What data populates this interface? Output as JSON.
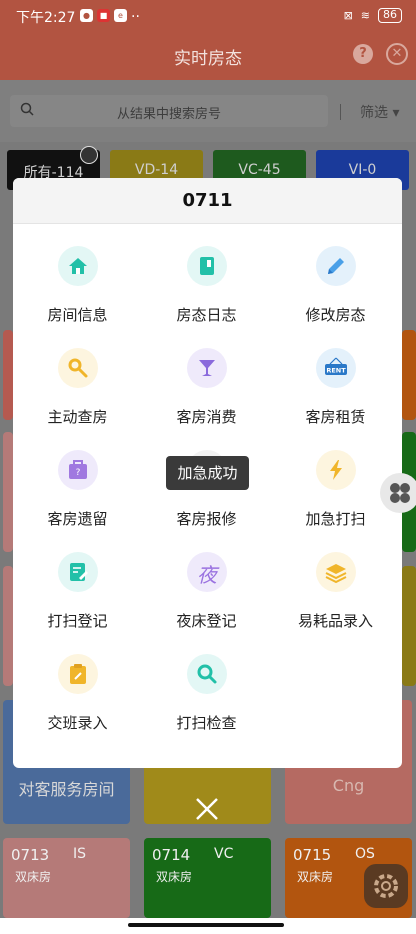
{
  "status": {
    "time": "下午2:27",
    "battery": "86",
    "icon3": "e"
  },
  "header": {
    "title": "实时房态",
    "help": "?",
    "close": "✕"
  },
  "search": {
    "placeholder": "从结果中搜索房号",
    "filter": "筛选 ▾"
  },
  "categories": [
    {
      "label": "所有-114",
      "color": "#111111"
    },
    {
      "label": "VD-14",
      "color": "#8a7a16"
    },
    {
      "label": "VC-45",
      "color": "#1e5a1e"
    },
    {
      "label": "VI-0",
      "color": "#1a3a9a"
    }
  ],
  "bg_cards": [
    {
      "label": "对客服务房间",
      "color": "#4a6a9a"
    },
    {
      "label": "Cng",
      "color": "#b56a62"
    }
  ],
  "rooms": [
    {
      "num": "0713",
      "status": "IS",
      "type": "双床房",
      "color": "#b57a78"
    },
    {
      "num": "0714",
      "status": "VC",
      "type": "双床房",
      "color": "#176a17"
    },
    {
      "num": "0715",
      "status": "OS",
      "type": "双床房",
      "color": "#b2550f"
    }
  ],
  "modal": {
    "title": "0711",
    "items": [
      {
        "label": "房间信息",
        "icon": "home-icon",
        "bg": "#e3f7f5",
        "fg": "#22c0a8"
      },
      {
        "label": "房态日志",
        "icon": "log-book-icon",
        "bg": "#e3f7f5",
        "fg": "#22c0a8"
      },
      {
        "label": "修改房态",
        "icon": "pencil-icon",
        "bg": "#e4f1fb",
        "fg": "#4aa0e8"
      },
      {
        "label": "主动查房",
        "icon": "magnifier-key-icon",
        "bg": "#fdf5df",
        "fg": "#f0b52a"
      },
      {
        "label": "客房消费",
        "icon": "cocktail-icon",
        "bg": "#efeafb",
        "fg": "#8a6adc"
      },
      {
        "label": "客房租赁",
        "icon": "rent-sign-icon",
        "bg": "#e4f1fb",
        "fg": "#2a78c8"
      },
      {
        "label": "客房遗留",
        "icon": "lost-bag-icon",
        "bg": "#efeafb",
        "fg": "#a078e0"
      },
      {
        "label": "客房报修",
        "icon": "repair-icon",
        "bg": "#f2f2f2",
        "fg": "#999999"
      },
      {
        "label": "加急打扫",
        "icon": "lightning-icon",
        "bg": "#fdf5df",
        "fg": "#f0b52a"
      },
      {
        "label": "打扫登记",
        "icon": "clean-register-icon",
        "bg": "#e3f7f5",
        "fg": "#22c0a8"
      },
      {
        "label": "夜床登记",
        "icon": "night-icon",
        "bg": "#efeafb",
        "fg": "#9a72e0",
        "glyph": "夜"
      },
      {
        "label": "易耗品录入",
        "icon": "stack-icon",
        "bg": "#fdf5df",
        "fg": "#f0b52a"
      },
      {
        "label": "交班录入",
        "icon": "clipboard-icon",
        "bg": "#fdf5df",
        "fg": "#f0b52a"
      },
      {
        "label": "打扫检查",
        "icon": "search-check-icon",
        "bg": "#e3f7f5",
        "fg": "#22c0a8"
      }
    ],
    "toast": "加急成功",
    "rent_text": "RENT"
  }
}
